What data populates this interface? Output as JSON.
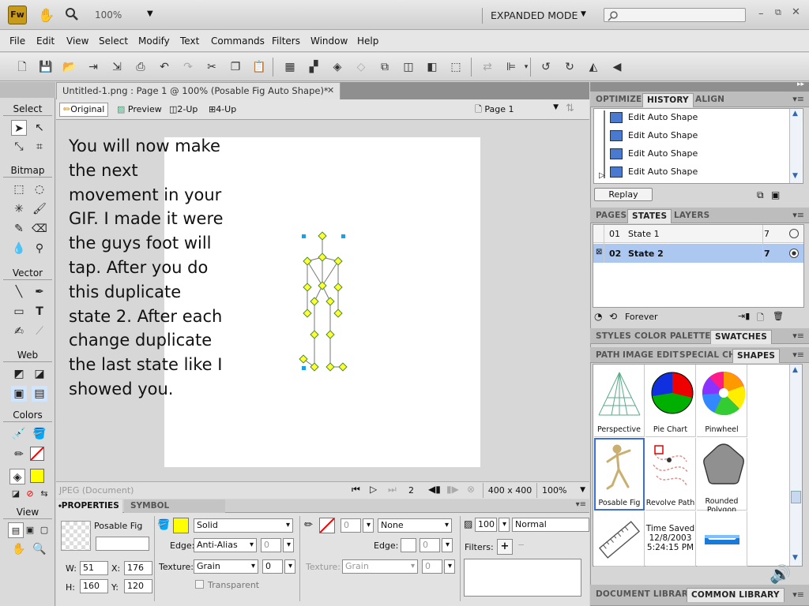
{
  "app": {
    "logo": "Fw",
    "zoom": "100%",
    "mode": "EXPANDED MODE",
    "search_placeholder": ""
  },
  "menu": [
    "File",
    "Edit",
    "View",
    "Select",
    "Modify",
    "Text",
    "Commands",
    "Filters",
    "Window",
    "Help"
  ],
  "document": {
    "tab_title": "Untitled-1.png : Page 1 @ 100% (Posable Fig Auto Shape)*",
    "views": [
      "Original",
      "Preview",
      "2-Up",
      "4-Up"
    ],
    "page": "Page 1",
    "overlay_text": "You will now make the next movement in your GIF. I made it were the guys foot will tap. After you do this duplicate state 2. After each change duplicate the last state like I showed you."
  },
  "status": {
    "format": "JPEG (Document)",
    "frame": "2",
    "size": "400 x 400",
    "zoom": "100%"
  },
  "tools": {
    "sections": [
      "Select",
      "Bitmap",
      "Vector",
      "Web",
      "Colors",
      "View"
    ]
  },
  "properties": {
    "tabs": [
      "PROPERTIES",
      "SYMBOL PROPERTIES"
    ],
    "object_name": "Posable Fig",
    "w_label": "W:",
    "w": "51",
    "x_label": "X:",
    "x": "176",
    "h_label": "H:",
    "h": "160",
    "y_label": "Y:",
    "y": "120",
    "fill": "Solid",
    "edge_label": "Edge:",
    "fill_edge": "Anti-Alias",
    "fill_edge_val": "0",
    "texture_label": "Texture:",
    "texture": "Grain",
    "texture_val": "0",
    "transparent": "Transparent",
    "stroke_size": "0",
    "stroke": "None",
    "stroke_edge_val": "0",
    "stroke_texture": "Grain",
    "stroke_texture_val": "0",
    "opacity": "100",
    "blend": "Normal",
    "filters_label": "Filters:",
    "fill_color": "#ffff00"
  },
  "panels": {
    "group1_tabs": [
      "OPTIMIZE",
      "HISTORY",
      "ALIGN"
    ],
    "history": [
      "Edit Auto Shape",
      "Edit Auto Shape",
      "Edit Auto Shape",
      "Edit Auto Shape"
    ],
    "replay": "Replay",
    "group2_tabs": [
      "PAGES",
      "STATES",
      "LAYERS"
    ],
    "states": [
      {
        "num": "01",
        "name": "State 1",
        "delay": "7"
      },
      {
        "num": "02",
        "name": "State 2",
        "delay": "7"
      }
    ],
    "loop": "Forever",
    "group3_tabs": [
      "STYLES",
      "COLOR PALETTE",
      "SWATCHES"
    ],
    "group4_tabs": [
      "PATH",
      "IMAGE EDIT",
      "SPECIAL CH",
      "SHAPES"
    ],
    "shapes": [
      {
        "label": "Perspective"
      },
      {
        "label": "Pie Chart"
      },
      {
        "label": "Pinwheel"
      },
      {
        "label": "Posable Fig"
      },
      {
        "label": "Revolve Path"
      },
      {
        "label": "Rounded Polygon"
      },
      {
        "label": ""
      },
      {
        "label": "Time Saved 12/8/2003 5:24:15 PM"
      },
      {
        "label": ""
      }
    ],
    "bottom_tabs": [
      "DOCUMENT LIBRARY",
      "COMMON LIBRARY"
    ]
  }
}
